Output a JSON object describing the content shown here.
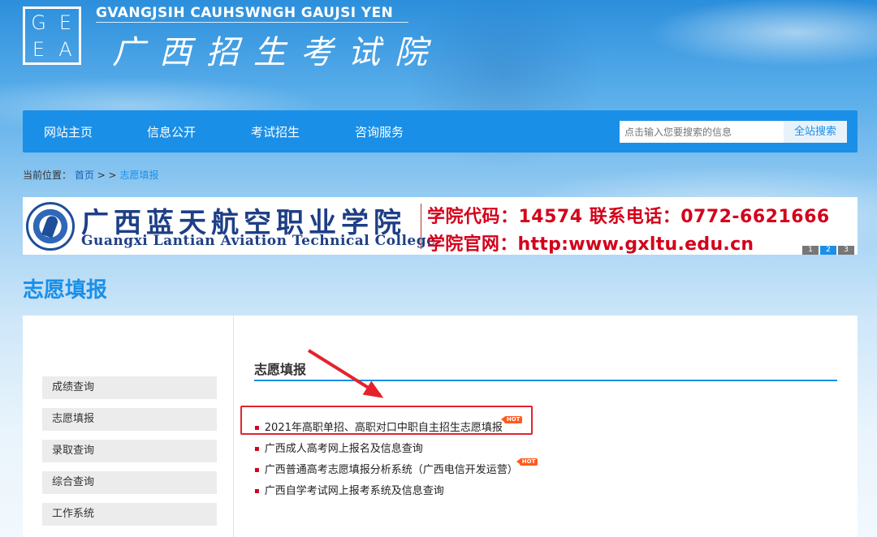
{
  "header": {
    "logo_letters": [
      "G",
      "E",
      "E",
      "A"
    ],
    "site_name_en": "GVANGJSIH CAUHSWNGH GAUJSI YEN",
    "site_name_cn": "广西招生考试院"
  },
  "nav": {
    "items": [
      "网站主页",
      "信息公开",
      "考试招生",
      "咨询服务"
    ],
    "search_placeholder": "点击输入您要搜索的信息",
    "search_button": "全站搜索"
  },
  "breadcrumb": {
    "prefix": "当前位置：",
    "home": "首页",
    "separator": " > > ",
    "current": "志愿填报"
  },
  "banner": {
    "college_cn": "广西蓝天航空职业学院",
    "college_en": "Guangxi Lantian Aviation Technical College",
    "code_line": "学院代码：14574   联系电话：0772-6621666",
    "web_line": "学院官网：http:www.gxltu.edu.cn",
    "pages": [
      "1",
      "2",
      "3"
    ],
    "active_page": 2
  },
  "page_title": "志愿填报",
  "sidebar": {
    "items": [
      "成绩查询",
      "志愿填报",
      "录取查询",
      "综合查询",
      "工作系统"
    ]
  },
  "main": {
    "section_title": "志愿填报",
    "hot_label": "HOT",
    "links": [
      {
        "text": "2021年高职单招、高职对口中职自主招生志愿填报",
        "hot": true
      },
      {
        "text": "广西成人高考网上报名及信息查询",
        "hot": false
      },
      {
        "text": "广西普通高考志愿填报分析系统（广西电信开发运营）",
        "hot": true
      },
      {
        "text": "广西自学考试网上报考系统及信息查询",
        "hot": false
      }
    ]
  },
  "colors": {
    "primary": "#1a8fe8",
    "annotation_red": "#e5222c",
    "hot_orange": "#ff5a1f"
  }
}
